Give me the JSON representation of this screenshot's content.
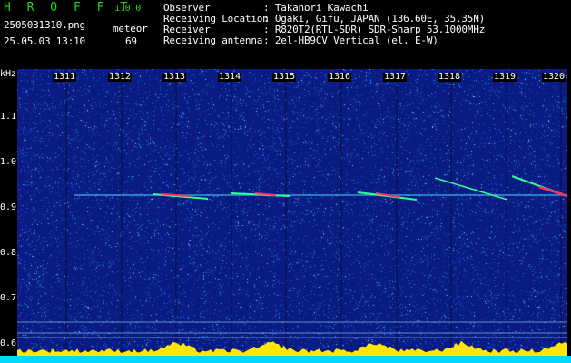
{
  "header": {
    "app_title": "H R O F F T",
    "app_version": "1.0.0",
    "filename": "2505031310.png",
    "timestamp": "25.05.03 13:10",
    "detect_label": "meteor",
    "detect_count": "69",
    "info": [
      {
        "key": "Observer",
        "value": ": Takanori Kawachi"
      },
      {
        "key": "Receiving Location",
        "value": ": Ogaki, Gifu, JAPAN (136.60E, 35.35N)"
      },
      {
        "key": "Receiver",
        "value": ": R820T2(RTL-SDR) SDR-Sharp 53.1000MHz"
      },
      {
        "key": "Receiving antenna",
        "value": ": 2el-HB9CV Vertical (el. E-W)"
      }
    ]
  },
  "axis": {
    "unit": "kHz",
    "y_ticks": [
      "1.1",
      "1.0",
      "0.9",
      "0.8",
      "0.7",
      "0.6"
    ],
    "minutes": [
      "1311",
      "1312",
      "1313",
      "1314",
      "1315",
      "1316",
      "1317",
      "1318",
      "1319",
      "1320"
    ]
  },
  "colors": {
    "background": "#0a1b83",
    "noise": "#28aaff",
    "echo_strong": "#ff3060",
    "echo_mid": "#30ff90",
    "level_bar": "#ffe600",
    "bottom_bar": "#00d8ff"
  }
}
